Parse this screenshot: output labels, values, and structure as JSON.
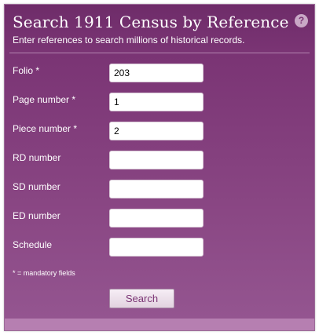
{
  "header": {
    "title": "Search 1911 Census by Reference",
    "subtitle": "Enter references to search millions of historical records.",
    "help_label": "?"
  },
  "form": {
    "fields": [
      {
        "label": "Folio *",
        "value": "203"
      },
      {
        "label": "Page number *",
        "value": "1"
      },
      {
        "label": "Piece number *",
        "value": "2"
      },
      {
        "label": "RD number",
        "value": ""
      },
      {
        "label": "SD number",
        "value": ""
      },
      {
        "label": "ED number",
        "value": ""
      },
      {
        "label": "Schedule",
        "value": ""
      }
    ],
    "mandatory_note": "* = mandatory fields",
    "search_label": "Search"
  },
  "colors": {
    "panel": "#7a3474",
    "footer": "#b67fb1",
    "button_text": "#7a3474"
  }
}
